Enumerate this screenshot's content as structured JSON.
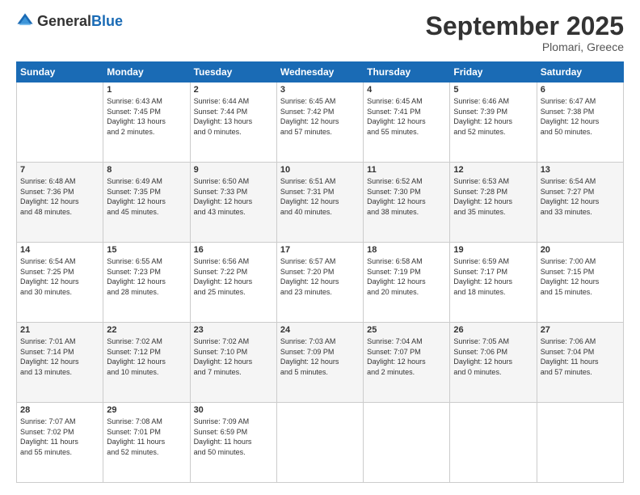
{
  "header": {
    "logo": {
      "general": "General",
      "blue": "Blue"
    },
    "title": "September 2025",
    "location": "Plomari, Greece"
  },
  "calendar": {
    "days_of_week": [
      "Sunday",
      "Monday",
      "Tuesday",
      "Wednesday",
      "Thursday",
      "Friday",
      "Saturday"
    ],
    "weeks": [
      [
        {
          "day": "",
          "info": ""
        },
        {
          "day": "1",
          "info": "Sunrise: 6:43 AM\nSunset: 7:45 PM\nDaylight: 13 hours\nand 2 minutes."
        },
        {
          "day": "2",
          "info": "Sunrise: 6:44 AM\nSunset: 7:44 PM\nDaylight: 13 hours\nand 0 minutes."
        },
        {
          "day": "3",
          "info": "Sunrise: 6:45 AM\nSunset: 7:42 PM\nDaylight: 12 hours\nand 57 minutes."
        },
        {
          "day": "4",
          "info": "Sunrise: 6:45 AM\nSunset: 7:41 PM\nDaylight: 12 hours\nand 55 minutes."
        },
        {
          "day": "5",
          "info": "Sunrise: 6:46 AM\nSunset: 7:39 PM\nDaylight: 12 hours\nand 52 minutes."
        },
        {
          "day": "6",
          "info": "Sunrise: 6:47 AM\nSunset: 7:38 PM\nDaylight: 12 hours\nand 50 minutes."
        }
      ],
      [
        {
          "day": "7",
          "info": "Sunrise: 6:48 AM\nSunset: 7:36 PM\nDaylight: 12 hours\nand 48 minutes."
        },
        {
          "day": "8",
          "info": "Sunrise: 6:49 AM\nSunset: 7:35 PM\nDaylight: 12 hours\nand 45 minutes."
        },
        {
          "day": "9",
          "info": "Sunrise: 6:50 AM\nSunset: 7:33 PM\nDaylight: 12 hours\nand 43 minutes."
        },
        {
          "day": "10",
          "info": "Sunrise: 6:51 AM\nSunset: 7:31 PM\nDaylight: 12 hours\nand 40 minutes."
        },
        {
          "day": "11",
          "info": "Sunrise: 6:52 AM\nSunset: 7:30 PM\nDaylight: 12 hours\nand 38 minutes."
        },
        {
          "day": "12",
          "info": "Sunrise: 6:53 AM\nSunset: 7:28 PM\nDaylight: 12 hours\nand 35 minutes."
        },
        {
          "day": "13",
          "info": "Sunrise: 6:54 AM\nSunset: 7:27 PM\nDaylight: 12 hours\nand 33 minutes."
        }
      ],
      [
        {
          "day": "14",
          "info": "Sunrise: 6:54 AM\nSunset: 7:25 PM\nDaylight: 12 hours\nand 30 minutes."
        },
        {
          "day": "15",
          "info": "Sunrise: 6:55 AM\nSunset: 7:23 PM\nDaylight: 12 hours\nand 28 minutes."
        },
        {
          "day": "16",
          "info": "Sunrise: 6:56 AM\nSunset: 7:22 PM\nDaylight: 12 hours\nand 25 minutes."
        },
        {
          "day": "17",
          "info": "Sunrise: 6:57 AM\nSunset: 7:20 PM\nDaylight: 12 hours\nand 23 minutes."
        },
        {
          "day": "18",
          "info": "Sunrise: 6:58 AM\nSunset: 7:19 PM\nDaylight: 12 hours\nand 20 minutes."
        },
        {
          "day": "19",
          "info": "Sunrise: 6:59 AM\nSunset: 7:17 PM\nDaylight: 12 hours\nand 18 minutes."
        },
        {
          "day": "20",
          "info": "Sunrise: 7:00 AM\nSunset: 7:15 PM\nDaylight: 12 hours\nand 15 minutes."
        }
      ],
      [
        {
          "day": "21",
          "info": "Sunrise: 7:01 AM\nSunset: 7:14 PM\nDaylight: 12 hours\nand 13 minutes."
        },
        {
          "day": "22",
          "info": "Sunrise: 7:02 AM\nSunset: 7:12 PM\nDaylight: 12 hours\nand 10 minutes."
        },
        {
          "day": "23",
          "info": "Sunrise: 7:02 AM\nSunset: 7:10 PM\nDaylight: 12 hours\nand 7 minutes."
        },
        {
          "day": "24",
          "info": "Sunrise: 7:03 AM\nSunset: 7:09 PM\nDaylight: 12 hours\nand 5 minutes."
        },
        {
          "day": "25",
          "info": "Sunrise: 7:04 AM\nSunset: 7:07 PM\nDaylight: 12 hours\nand 2 minutes."
        },
        {
          "day": "26",
          "info": "Sunrise: 7:05 AM\nSunset: 7:06 PM\nDaylight: 12 hours\nand 0 minutes."
        },
        {
          "day": "27",
          "info": "Sunrise: 7:06 AM\nSunset: 7:04 PM\nDaylight: 11 hours\nand 57 minutes."
        }
      ],
      [
        {
          "day": "28",
          "info": "Sunrise: 7:07 AM\nSunset: 7:02 PM\nDaylight: 11 hours\nand 55 minutes."
        },
        {
          "day": "29",
          "info": "Sunrise: 7:08 AM\nSunset: 7:01 PM\nDaylight: 11 hours\nand 52 minutes."
        },
        {
          "day": "30",
          "info": "Sunrise: 7:09 AM\nSunset: 6:59 PM\nDaylight: 11 hours\nand 50 minutes."
        },
        {
          "day": "",
          "info": ""
        },
        {
          "day": "",
          "info": ""
        },
        {
          "day": "",
          "info": ""
        },
        {
          "day": "",
          "info": ""
        }
      ]
    ]
  }
}
